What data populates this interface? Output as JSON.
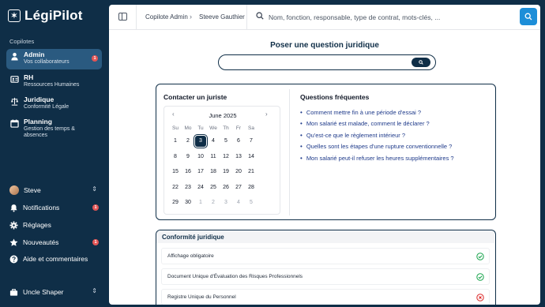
{
  "app": {
    "name": "LégiPilot",
    "logo_glyph": "✶"
  },
  "sidebar": {
    "section_label": "Copilotes",
    "items": [
      {
        "title": "Admin",
        "subtitle": "Vos collaborateurs",
        "icon": "person-icon",
        "badge": "1",
        "active": true
      },
      {
        "title": "RH",
        "subtitle": "Ressources Humaines",
        "icon": "id-card-icon"
      },
      {
        "title": "Juridique",
        "subtitle": "Conformité Légale",
        "icon": "scales-icon"
      },
      {
        "title": "Planning",
        "subtitle": "Gestion des temps & absences",
        "icon": "calendar-icon"
      }
    ],
    "user": {
      "name": "Steve"
    },
    "bottom": [
      {
        "label": "Notifications",
        "icon": "bell-icon",
        "badge": "1"
      },
      {
        "label": "Réglages",
        "icon": "gear-icon"
      },
      {
        "label": "Nouveautés",
        "icon": "star-icon",
        "badge": "1"
      },
      {
        "label": "Aide et commentaires",
        "icon": "help-icon"
      }
    ],
    "account": {
      "name": "Uncle Shaper"
    }
  },
  "header": {
    "breadcrumb": [
      "Copilote Admin",
      "Steeve Gauthier"
    ],
    "search_placeholder": "Nom, fonction, responsable, type de contrat, mots-clés, ..."
  },
  "question": {
    "title": "Poser une question juridique",
    "placeholder": ""
  },
  "contact": {
    "title": "Contacter un juriste",
    "calendar": {
      "month": "June 2025",
      "weekdays": [
        "Su",
        "Mo",
        "Tu",
        "We",
        "Th",
        "Fr",
        "Sa"
      ],
      "weeks": [
        [
          "1",
          "2",
          "3",
          "4",
          "5",
          "6",
          "7"
        ],
        [
          "8",
          "9",
          "10",
          "11",
          "12",
          "13",
          "14"
        ],
        [
          "15",
          "16",
          "17",
          "18",
          "19",
          "20",
          "21"
        ],
        [
          "22",
          "23",
          "24",
          "25",
          "26",
          "27",
          "28"
        ],
        [
          "29",
          "30",
          "1",
          "2",
          "3",
          "4",
          "5"
        ]
      ],
      "selected": "3"
    }
  },
  "faq": {
    "title": "Questions fréquentes",
    "items": [
      "Comment mettre fin à une période d'essai ?",
      "Mon salarié est malade, comment le déclarer ?",
      "Qu'est-ce que le règlement intérieur ?",
      "Quelles sont les étapes d'une rupture conventionnelle ?",
      "Mon salarié peut-il refuser les heures supplémentaires ?"
    ]
  },
  "compliance": {
    "title": "Conformité juridique",
    "rows": [
      {
        "label": "Affichage obligatoire",
        "status": "ok"
      },
      {
        "label": "Document Unique d'Évaluation des Risques Professionnels",
        "status": "ok"
      },
      {
        "label": "Registre Unique du Personnel",
        "status": "missing"
      }
    ]
  },
  "colors": {
    "navy": "#0f2e47",
    "accent": "#1d8ed8",
    "ok": "#16a34a",
    "missing": "#dc2626",
    "badge": "#e25555"
  }
}
